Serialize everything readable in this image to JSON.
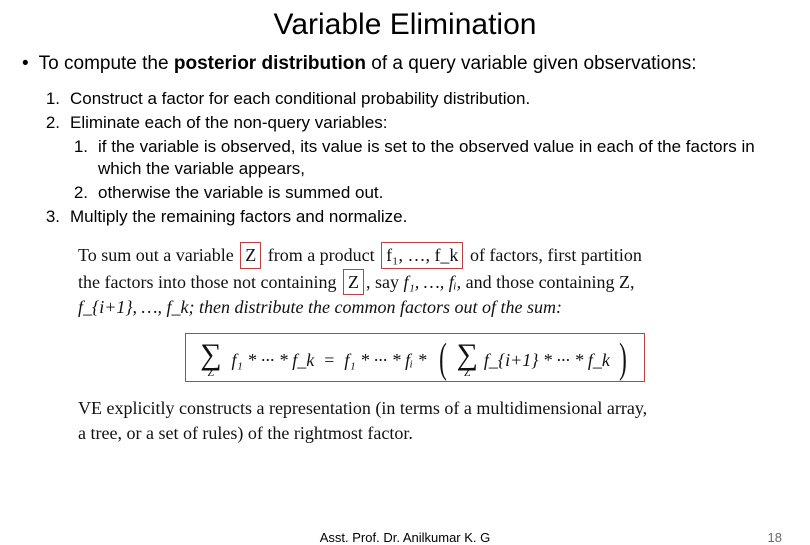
{
  "title": "Variable Elimination",
  "bullet": {
    "pre": "To compute the ",
    "strong": "posterior distribution",
    "post": " of a query variable given observations:"
  },
  "steps": {
    "n1": "1.",
    "t1": "Construct a factor for each conditional probability distribution.",
    "n2": "2.",
    "t2": "Eliminate each of the non-query variables:",
    "sub_n1": "1.",
    "sub_t1": "if the variable is observed, its value is set to the observed value in each of the factors in which the variable appears,",
    "sub_n2": "2.",
    "sub_t2": "otherwise the variable is summed out.",
    "n3": "3.",
    "t3": "Multiply the remaining factors and normalize."
  },
  "excerpt": {
    "a1": "To sum out a variable ",
    "z": "Z",
    "a2": " from a product ",
    "prod1": "f₁, …, f_k",
    "a3": " of factors, first partition",
    "b1": "the factors into those not containing ",
    "b2": ", say ",
    "b3": "f₁, …, fᵢ,",
    "b4": " and those containing Z,",
    "c1": "f_{i+1}, …, f_k; then distribute the common factors out of the sum:",
    "d1": "VE explicitly constructs a representation (in terms of a multidimensional array,",
    "d2": "a tree, or a set of rules) of the rightmost factor."
  },
  "equation": {
    "sigma": "∑",
    "sub": "Z",
    "lhs": "f₁ * ··· * f_k",
    "eq": "=",
    "mid": "f₁ * ··· * fᵢ *",
    "rhs": "f_{i+1} * ··· * f_k"
  },
  "footer": {
    "author": "Asst. Prof. Dr. Anilkumar K. G",
    "page": "18"
  }
}
